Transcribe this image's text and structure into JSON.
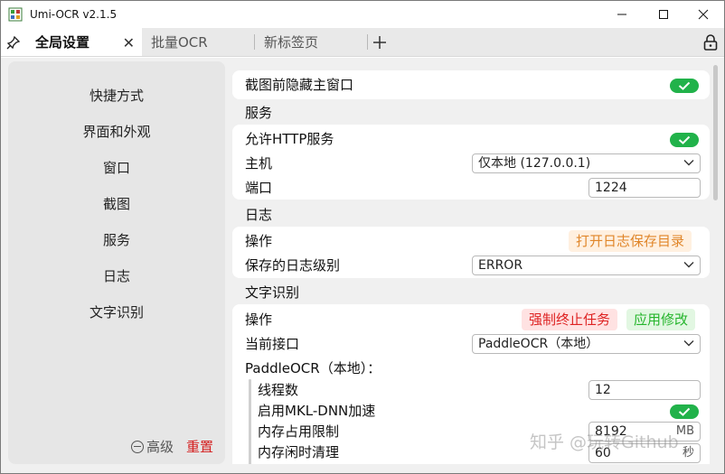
{
  "window": {
    "title": "Umi-OCR v2.1.5",
    "minimize_icon": "minimize-icon",
    "maximize_icon": "maximize-icon",
    "close_icon": "close-icon"
  },
  "tabs": [
    {
      "label": "全局设置",
      "active": true,
      "closable": true
    },
    {
      "label": "批量OCR",
      "active": false
    },
    {
      "label": "新标签页",
      "active": false
    }
  ],
  "sidebar": {
    "items": [
      "快捷方式",
      "界面和外观",
      "窗口",
      "截图",
      "服务",
      "日志",
      "文字识别"
    ],
    "advanced_label": "高级",
    "reset_label": "重置"
  },
  "settings": {
    "hide_window_label": "截图前隐藏主窗口",
    "hide_window_on": true,
    "service_title": "服务",
    "allow_http_label": "允许HTTP服务",
    "allow_http_on": true,
    "host_label": "主机",
    "host_value": "仅本地 (127.0.0.1)",
    "port_label": "端口",
    "port_value": "1224",
    "log_title": "日志",
    "log_action_label": "操作",
    "open_log_dir_label": "打开日志保存目录",
    "log_level_label": "保存的日志级别",
    "log_level_value": "ERROR",
    "ocr_title": "文字识别",
    "ocr_action_label": "操作",
    "force_stop_label": "强制终止任务",
    "apply_label": "应用修改",
    "current_api_label": "当前接口",
    "current_api_value": "PaddleOCR（本地）",
    "paddle_title": "PaddleOCR（本地）：",
    "threads_label": "线程数",
    "threads_value": "12",
    "mkldnn_label": "启用MKL-DNN加速",
    "mkldnn_on": true,
    "mem_limit_label": "内存占用限制",
    "mem_limit_value": "8192",
    "mem_limit_unit": "MB",
    "mem_idle_label": "内存闲时清理",
    "mem_idle_value": "60",
    "mem_idle_unit": "秒"
  },
  "watermark": "知乎 @玩转Github",
  "colors": {
    "toggle_on": "#21b24a",
    "danger": "#de2222",
    "success": "#25b52c",
    "warn": "#e0862a"
  }
}
